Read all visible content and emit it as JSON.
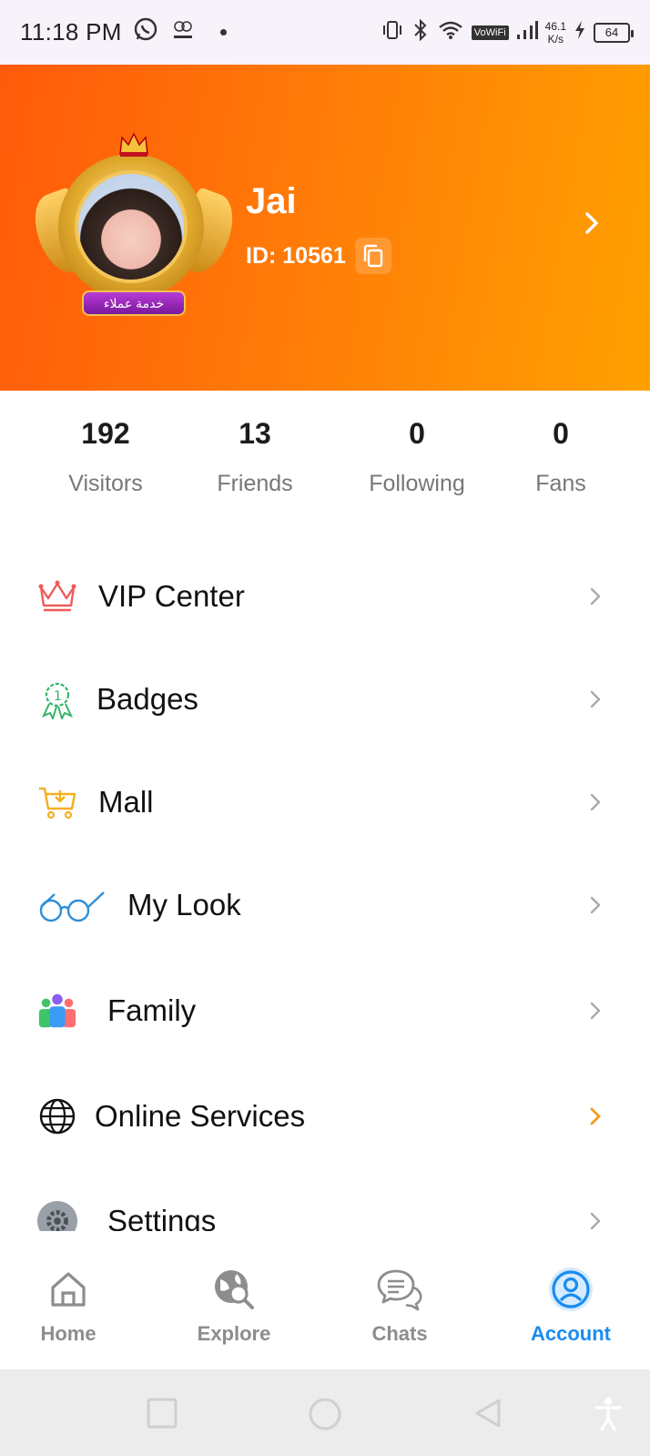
{
  "status_bar": {
    "time": "11:18 PM",
    "net_speed_value": "46.1",
    "net_speed_unit": "K/s",
    "wifi_label": "VoWiFi",
    "battery": "64"
  },
  "profile": {
    "name": "Jai",
    "id_text": "ID: 10561",
    "avatar_banner_text": "خدمة عملاء"
  },
  "stats": [
    {
      "value": "192",
      "label": "Visitors"
    },
    {
      "value": "13",
      "label": "Friends"
    },
    {
      "value": "0",
      "label": "Following"
    },
    {
      "value": "0",
      "label": "Fans"
    }
  ],
  "menu": [
    {
      "label": "VIP Center",
      "icon": "crown-icon"
    },
    {
      "label": "Badges",
      "icon": "badge-icon"
    },
    {
      "label": "Mall",
      "icon": "cart-icon"
    },
    {
      "label": "My Look",
      "icon": "glasses-icon"
    },
    {
      "label": "Family",
      "icon": "family-icon"
    },
    {
      "label": "Online Services",
      "icon": "globe-icon"
    },
    {
      "label": "Settings",
      "icon": "gear-icon"
    }
  ],
  "bottom_nav": [
    {
      "label": "Home",
      "icon": "home-icon",
      "active": false
    },
    {
      "label": "Explore",
      "icon": "explore-icon",
      "active": false
    },
    {
      "label": "Chats",
      "icon": "chat-icon",
      "active": false
    },
    {
      "label": "Account",
      "icon": "account-icon",
      "active": true
    }
  ],
  "colors": {
    "header_gradient_start": "#ff5a0a",
    "header_gradient_end": "#ffa100",
    "active_tab": "#1a8cf0",
    "online_services_chevron": "#f39a1c"
  }
}
